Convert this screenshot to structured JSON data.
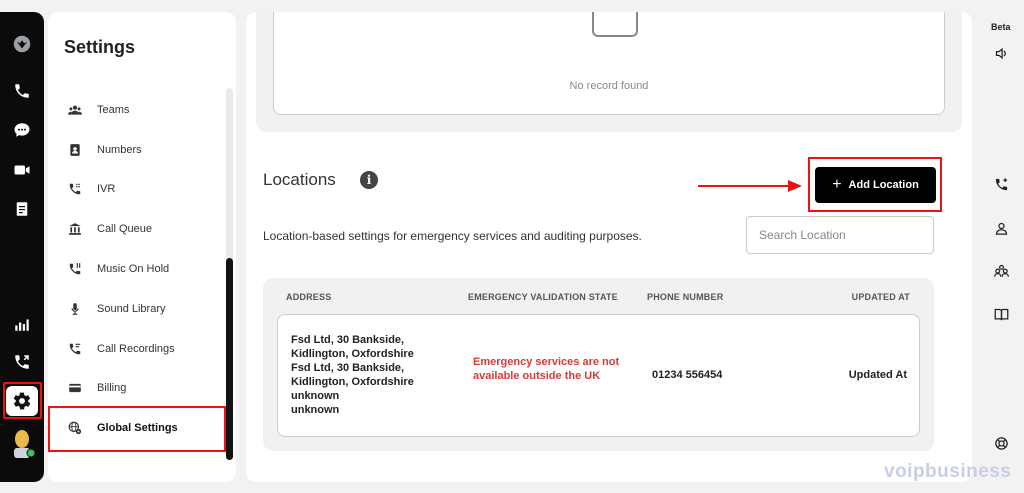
{
  "rail": {
    "icons": [
      "logo-icon",
      "phone-icon",
      "chat-icon",
      "video-icon",
      "notes-icon",
      "analytics-icon",
      "phone-forward-icon",
      "gear-icon",
      "avatar"
    ]
  },
  "sidebar": {
    "title": "Settings",
    "items": [
      {
        "label": "Teams",
        "icon": "teams-icon"
      },
      {
        "label": "Numbers",
        "icon": "contacts-icon"
      },
      {
        "label": "IVR",
        "icon": "ivr-icon"
      },
      {
        "label": "Call Queue",
        "icon": "call-queue-icon"
      },
      {
        "label": "Music On Hold",
        "icon": "music-on-hold-icon"
      },
      {
        "label": "Sound Library",
        "icon": "microphone-icon"
      },
      {
        "label": "Call Recordings",
        "icon": "call-recordings-icon"
      },
      {
        "label": "Billing",
        "icon": "billing-icon"
      },
      {
        "label": "Global Settings",
        "icon": "globe-gear-icon"
      }
    ],
    "active": "Global Settings"
  },
  "records": {
    "empty_text": "No record found"
  },
  "locations": {
    "title": "Locations",
    "description": "Location-based settings for emergency services and auditing purposes.",
    "add_button": "Add Location",
    "search_placeholder": "Search Location",
    "columns": [
      "ADDRESS",
      "EMERGENCY VALIDATION STATE",
      "PHONE NUMBER",
      "UPDATED AT"
    ],
    "rows": [
      {
        "address_lines": [
          "Fsd Ltd, 30 Bankside,",
          "Kidlington, Oxfordshire",
          "Fsd Ltd, 30 Bankside,",
          "Kidlington, Oxfordshire",
          "unknown",
          "unknown"
        ],
        "state_lines": [
          "Emergency services are not",
          "available outside the UK"
        ],
        "phone": "01234 556454",
        "updated_at": "Updated At"
      }
    ],
    "state_color": "#d63a3a"
  },
  "right_rail": {
    "beta_label": "Beta"
  },
  "watermark": "voipbusiness",
  "highlight_color": "#e11111"
}
